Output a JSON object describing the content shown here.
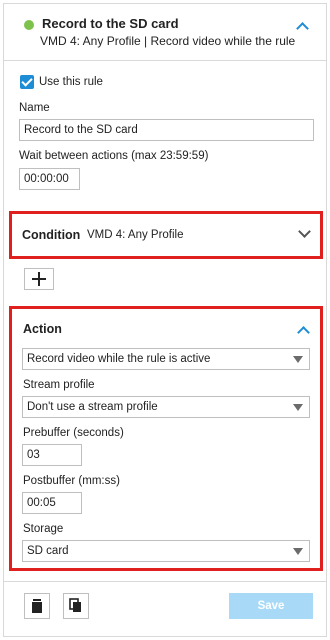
{
  "rule": {
    "status_color": "#7dc24b",
    "title": "Record to the SD card",
    "subtitle": "VMD 4: Any Profile | Record video while the rule is active",
    "use_rule_label": "Use this rule",
    "use_rule_checked": true,
    "name_label": "Name",
    "name_value": "Record to the SD card",
    "wait_label": "Wait between actions (max 23:59:59)",
    "wait_value": "00:00:00"
  },
  "condition": {
    "title": "Condition",
    "value": "VMD 4: Any Profile"
  },
  "add_button": {
    "icon": "plus-icon"
  },
  "action": {
    "title": "Action",
    "action_value": "Record video while the rule is active",
    "stream_label": "Stream profile",
    "stream_value": "Don't use a stream profile",
    "prebuffer_label": "Prebuffer (seconds)",
    "prebuffer_value": "03",
    "postbuffer_label": "Postbuffer (mm:ss)",
    "postbuffer_value": "00:05",
    "storage_label": "Storage",
    "storage_value": "SD card"
  },
  "footer": {
    "delete_icon": "trash-icon",
    "copy_icon": "copy-icon",
    "save_label": "Save"
  },
  "colors": {
    "accent": "#1f8dd6",
    "highlight": "#e0201f",
    "save_disabled": "#a8daf7"
  }
}
